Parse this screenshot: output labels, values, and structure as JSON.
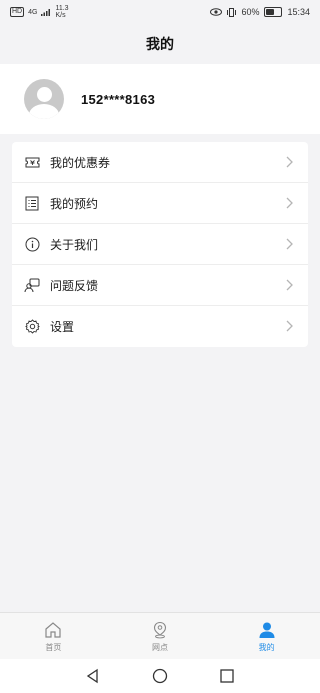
{
  "status_bar": {
    "hd": "HD",
    "signal": "4G",
    "speed_value": "11.3",
    "speed_unit": "K/s",
    "battery_pct": "60%",
    "battery_level": 0.6,
    "time": "15:34"
  },
  "header": {
    "title": "我的"
  },
  "profile": {
    "phone": "152****8163"
  },
  "menu": [
    {
      "label": "我的优惠券",
      "icon": "coupon-icon"
    },
    {
      "label": "我的预约",
      "icon": "list-icon"
    },
    {
      "label": "关于我们",
      "icon": "info-icon"
    },
    {
      "label": "问题反馈",
      "icon": "feedback-icon"
    },
    {
      "label": "设置",
      "icon": "gear-icon"
    }
  ],
  "tabbar": [
    {
      "label": "首页",
      "icon": "home-icon",
      "active": false
    },
    {
      "label": "网点",
      "icon": "location-icon",
      "active": false
    },
    {
      "label": "我的",
      "icon": "person-icon",
      "active": true
    }
  ],
  "colors": {
    "accent": "#1f8be6",
    "background": "#f3f3f5"
  }
}
